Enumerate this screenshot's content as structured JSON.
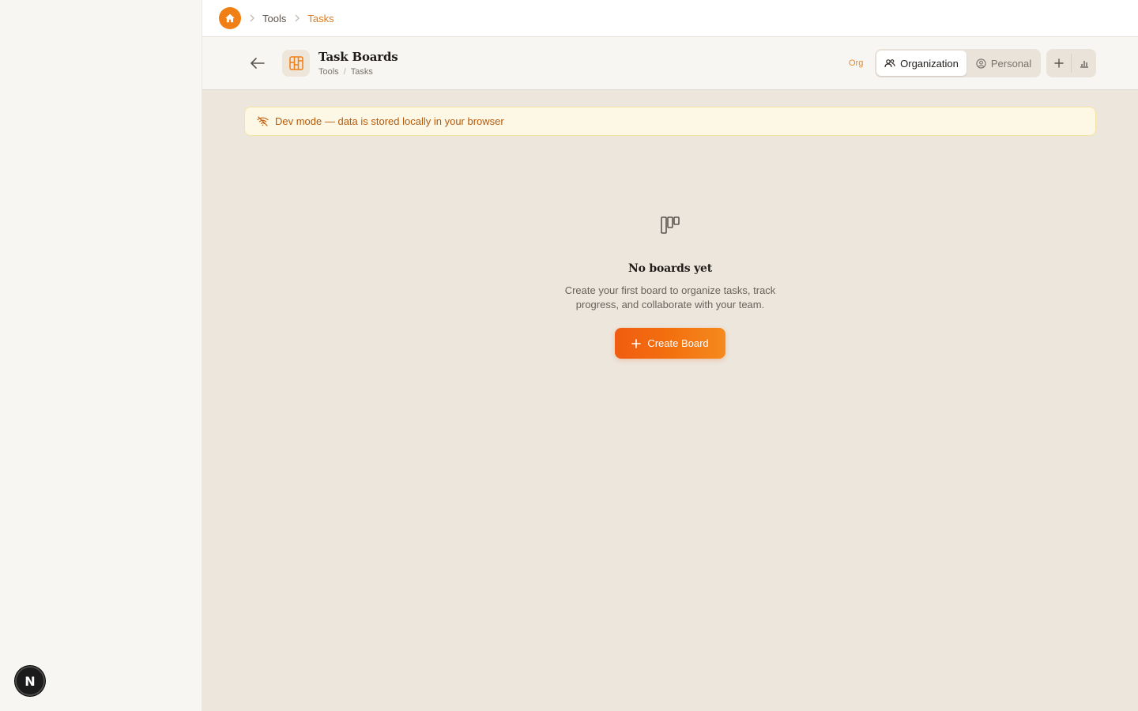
{
  "topbar": {
    "breadcrumb": [
      "Tools",
      "Tasks"
    ]
  },
  "header": {
    "title": "Task Boards",
    "subcrumbs": [
      "Tools",
      "Tasks"
    ],
    "scope_tag": "Org",
    "toggle": {
      "organization_label": "Organization",
      "personal_label": "Personal",
      "selected": "Organization"
    },
    "actions": [
      "plus-icon",
      "bar-chart-icon"
    ]
  },
  "banner": {
    "text": "Dev mode — data is stored locally in your browser",
    "icon": "wifi-off-icon"
  },
  "empty_state": {
    "icon": "kanban-icon",
    "title": "No boards yet",
    "description": "Create your first board to organize tasks, track progress, and collaborate with your team.",
    "button_label": "Create Board"
  },
  "dev_badge": {
    "label": "N"
  },
  "colors": {
    "accent": "#f07f16",
    "button_start": "#f05c10",
    "button_end": "#f58a1e",
    "banner_bg": "#fdf8e6",
    "banner_text": "#b45a0c",
    "page_bg": "#ece6dc",
    "sidebar_bg": "#f8f6f2"
  }
}
